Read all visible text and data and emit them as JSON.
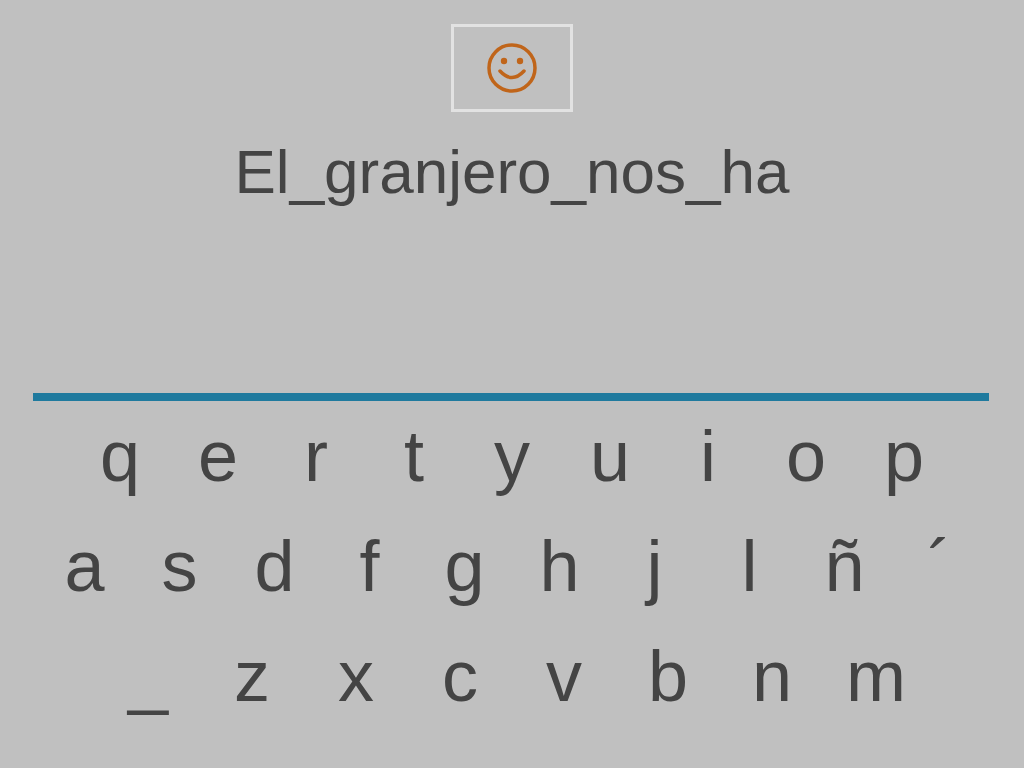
{
  "sentence": "El_granjero_nos_ha",
  "keyboard": [
    [
      "q",
      "e",
      "r",
      "t",
      "y",
      "u",
      "i",
      "o",
      "p"
    ],
    [
      "a",
      "s",
      "d",
      "f",
      "g",
      "h",
      "j",
      "l",
      "ñ",
      "´"
    ],
    [
      "_",
      "z",
      "x",
      "c",
      "v",
      "b",
      "n",
      "m"
    ]
  ]
}
